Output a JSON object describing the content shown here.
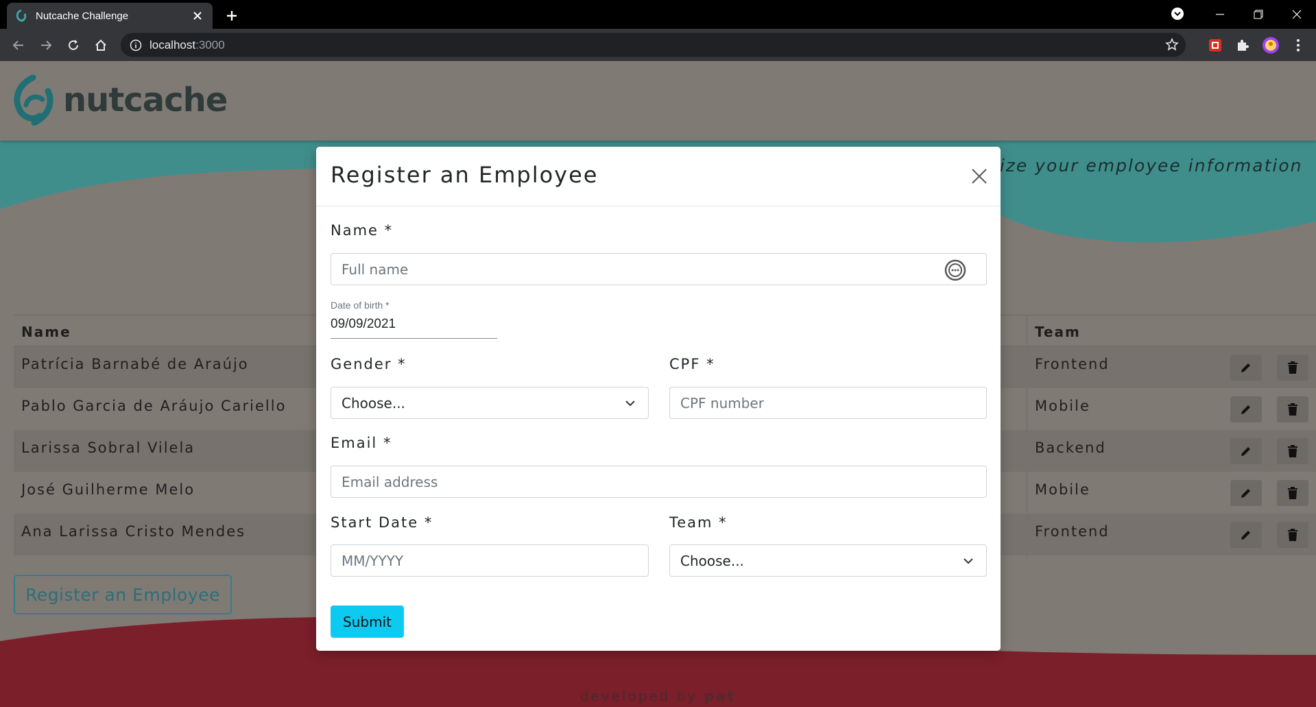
{
  "browser": {
    "tab_title": "Nutcache Challenge",
    "url_host": "localhost",
    "url_port": ":3000"
  },
  "header": {
    "logo_text": "nutcache"
  },
  "hero": {
    "tagline": "nize your employee information"
  },
  "table": {
    "headers": {
      "name": "Name",
      "team": "Team"
    },
    "rows": [
      {
        "name": "Patrícia Barnabé de Araújo",
        "team": "Frontend"
      },
      {
        "name": "Pablo Garcia de Aráujo Cariello",
        "team": "Mobile"
      },
      {
        "name": "Larissa Sobral Vilela",
        "team": "Backend"
      },
      {
        "name": "José Guilherme Melo",
        "team": "Mobile"
      },
      {
        "name": "Ana Larissa Cristo Mendes",
        "team": "Frontend"
      }
    ]
  },
  "register_button": "Register an Employee",
  "footer": {
    "text": "developed by",
    "author": "pat"
  },
  "modal": {
    "title": "Register an Employee",
    "name_label": "Name *",
    "name_placeholder": "Full name",
    "dob_label": "Date of birth *",
    "dob_value": "09/09/2021",
    "gender_label": "Gender *",
    "gender_value": "Choose...",
    "cpf_label": "CPF *",
    "cpf_placeholder": "CPF number",
    "email_label": "Email *",
    "email_placeholder": "Email address",
    "start_label": "Start Date *",
    "start_placeholder": "MM/YYYY",
    "team_label": "Team *",
    "team_value": "Choose...",
    "submit_label": "Submit"
  },
  "colors": {
    "brand_teal": "#2a8c8c",
    "footer_red": "#7b1f2a",
    "submit_cyan": "#0dcaf0"
  }
}
